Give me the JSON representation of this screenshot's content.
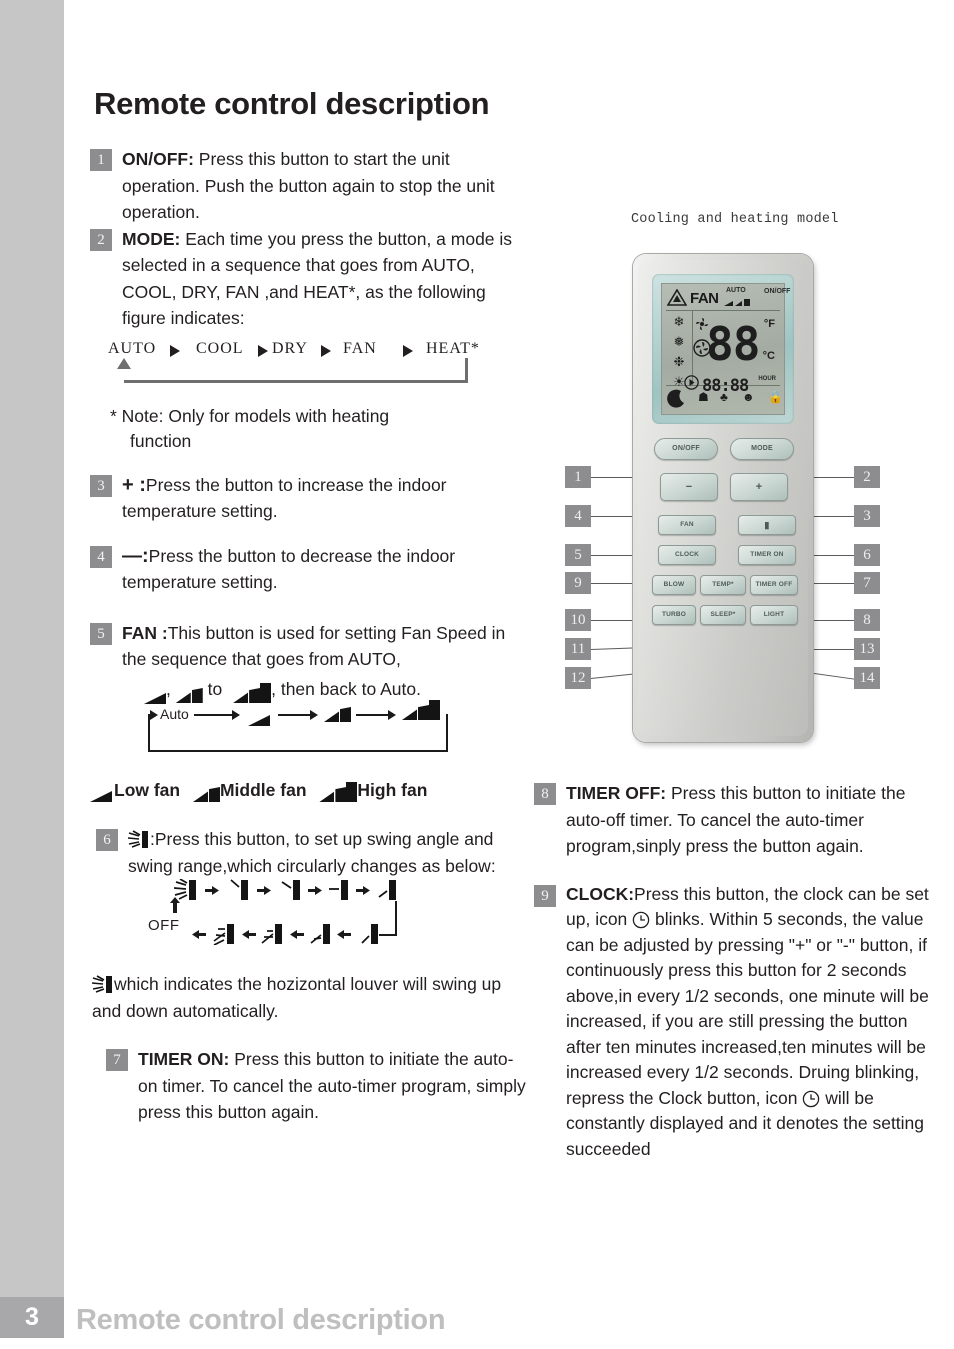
{
  "page": {
    "title": "Remote control description",
    "footer_number": "3",
    "footer_title": "Remote control description"
  },
  "figure": {
    "caption": "Cooling and heating model",
    "lcd": {
      "fan_label": "FAN",
      "auto_label": "AUTO",
      "digits": "88",
      "fahrenheit": "°F",
      "celsius": "°C",
      "time": "88:88",
      "hour_label": "HOUR",
      "onoff_label": "ON/OFF"
    },
    "buttons": [
      {
        "id": "on-off",
        "label": "ON/OFF"
      },
      {
        "id": "mode",
        "label": "MODE"
      },
      {
        "id": "minus",
        "label": "−"
      },
      {
        "id": "plus",
        "label": "+"
      },
      {
        "id": "fan",
        "label": "FAN"
      },
      {
        "id": "swing",
        "label": "▮"
      },
      {
        "id": "clock",
        "label": "CLOCK"
      },
      {
        "id": "timer-on",
        "label": "TIMER ON"
      },
      {
        "id": "blow",
        "label": "BLOW"
      },
      {
        "id": "temp",
        "label": "TEMP*"
      },
      {
        "id": "timer-off",
        "label": "TIMER OFF"
      },
      {
        "id": "turbo",
        "label": "TURBO"
      },
      {
        "id": "sleep",
        "label": "SLEEP*"
      },
      {
        "id": "light",
        "label": "LIGHT"
      }
    ],
    "callouts_left": [
      "1",
      "4",
      "5",
      "9",
      "10",
      "11",
      "12"
    ],
    "callouts_right": [
      "2",
      "3",
      "6",
      "7",
      "8",
      "13",
      "14"
    ]
  },
  "items": {
    "one": {
      "num": "1",
      "bold": "ON/OFF:",
      "text": " Press this button to start the unit operation. Push the button again to stop the unit operation."
    },
    "two": {
      "num": "2",
      "bold": "MODE:",
      "text": " Each time you press the button, a mode is selected in a sequence that goes from AUTO, COOL, DRY, FAN ,and HEAT*, as the following figure indicates:"
    },
    "three": {
      "num": "3",
      "bold": "+ :",
      "text": "Press the button to increase the indoor temperature setting."
    },
    "four": {
      "num": "4",
      "bold": "—:",
      "text": "Press the button to decrease the indoor temperature setting."
    },
    "five": {
      "num": "5",
      "bold": "FAN :",
      "text_a": "This button is used for setting Fan Speed in the sequence that goes from AUTO,",
      "text_b": ",",
      "text_c": "to",
      "text_d": ", then back to Auto."
    },
    "six": {
      "num": "6",
      "text_a": ":Press this button, to set up swing angle and swing range,which circularly changes as below:",
      "text_b": "which indicates the hozizontal louver will swing up and down automatically."
    },
    "seven": {
      "num": "7",
      "bold": "TIMER ON:",
      "text": " Press this button to initiate the auto-on timer. To cancel the auto-timer program, simply press this button again."
    },
    "eight": {
      "num": "8",
      "bold": "TIMER OFF:",
      "text": " Press this button to initiate the auto-off timer. To cancel the auto-timer program,sinply press the button again."
    },
    "nine": {
      "num": "9",
      "bold": "CLOCK:",
      "text_a": "Press this button, the clock can be set up, icon ",
      "text_b": " blinks. Within 5 seconds, the value can be adjusted by pressing \"+\" or \"-\" button, if continuously press this button for 2 seconds above,",
      "text_c": "in every 1/2 seconds, one minute will be increased, if you are still pressing the button after ten minutes increased,ten minutes will be increased every 1/2 seconds. Druing blinking, repress the Clock button, icon ",
      "text_d": " will be constantly displayed and it denotes the setting succeeded"
    }
  },
  "mode_sequence": {
    "steps": [
      "AUTO",
      "COOL",
      "DRY",
      "FAN",
      "HEAT*"
    ],
    "note": "* Note: Only for models with heating",
    "note_cont": "function"
  },
  "fan_sequence": {
    "auto_label": "Auto",
    "legend": [
      {
        "label": "Low fan"
      },
      {
        "label": "Middle fan"
      },
      {
        "label": "High fan"
      }
    ]
  },
  "swing_sequence": {
    "off_label": "OFF"
  },
  "colors": {
    "badge_gray": "#8d8d8f",
    "sidebar_gray": "#c6c6c6",
    "footer_gray": "#a8a8aa",
    "footer_text": "#bfbfbf",
    "text": "#231f20"
  }
}
